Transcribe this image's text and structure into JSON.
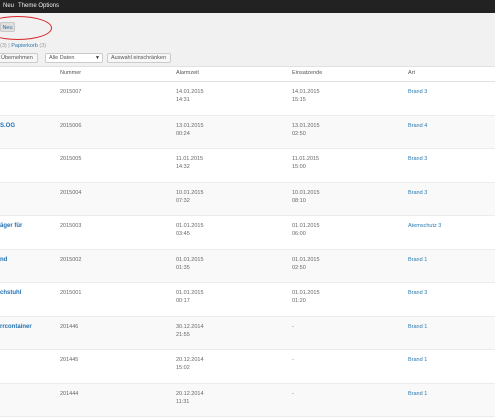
{
  "adminbar": {
    "new_label": "Neu",
    "theme_options_label": "Theme Options"
  },
  "add_new_button": "Neu",
  "sub_links": {
    "prefix": "(3) |",
    "trash_label": "Papierkorb",
    "trash_count": "(3)"
  },
  "filters": {
    "apply_button": "Übernehmen",
    "date_select_value": "Alle Daten",
    "filter_button": "Auswahl einschränken"
  },
  "columns": {
    "nummer": "Nummer",
    "alarmzeit": "Alarmzeit",
    "einsatzende": "Einsatzende",
    "art": "Art"
  },
  "rows": [
    {
      "title": "",
      "nummer": "2015007",
      "alarm_date": "14.01.2015",
      "alarm_time": "14:31",
      "end_date": "14.01.2015",
      "end_time": "15:15",
      "art": "Brand 3"
    },
    {
      "title": "S.OG",
      "nummer": "2015006",
      "alarm_date": "13.01.2015",
      "alarm_time": "00:24",
      "end_date": "13.01.2015",
      "end_time": "02:50",
      "art": "Brand 4"
    },
    {
      "title": "",
      "nummer": "2015005",
      "alarm_date": "11.01.2015",
      "alarm_time": "14:32",
      "end_date": "11.01.2015",
      "end_time": "15:00",
      "art": "Brand 3"
    },
    {
      "title": "",
      "nummer": "2015004",
      "alarm_date": "10.01.2015",
      "alarm_time": "07:32",
      "end_date": "10.01.2015",
      "end_time": "08:10",
      "art": "Brand 3"
    },
    {
      "title": "äger für",
      "nummer": "2015003",
      "alarm_date": "01.01.2015",
      "alarm_time": "03:45",
      "end_date": "01.01.2015",
      "end_time": "06:00",
      "art": "Atemschutz 3"
    },
    {
      "title": "nd",
      "nummer": "2015002",
      "alarm_date": "01.01.2015",
      "alarm_time": "01:35",
      "end_date": "01.01.2015",
      "end_time": "02:50",
      "art": "Brand 1"
    },
    {
      "title": "chstuhl",
      "nummer": "2015001",
      "alarm_date": "01.01.2015",
      "alarm_time": "00:17",
      "end_date": "01.01.2015",
      "end_time": "01:20",
      "art": "Brand 3"
    },
    {
      "title": "rrcontainer",
      "nummer": "201446",
      "alarm_date": "30.12.2014",
      "alarm_time": "21:55",
      "end_date": "-",
      "end_time": "",
      "art": "Brand 1"
    },
    {
      "title": "",
      "nummer": "201445",
      "alarm_date": "20.12.2014",
      "alarm_time": "15:02",
      "end_date": "-",
      "end_time": "",
      "art": "Brand 1"
    },
    {
      "title": "",
      "nummer": "201444",
      "alarm_date": "20.12.2014",
      "alarm_time": "11:31",
      "end_date": "-",
      "end_time": "",
      "art": "Brand 1"
    }
  ],
  "colors": {
    "link": "#2a7ab0",
    "adminbar": "#222222",
    "highlight_circle": "#d6242a"
  }
}
